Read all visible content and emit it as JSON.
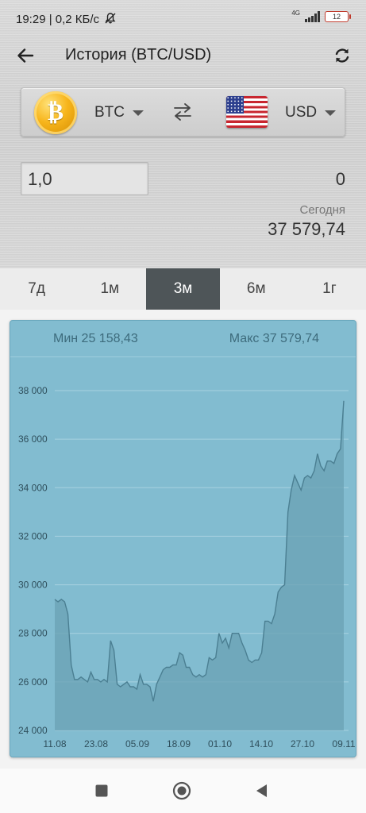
{
  "status": {
    "time_speed": "19:29 | 0,2 КБ/с",
    "network": "4G",
    "battery": "12"
  },
  "header": {
    "title": "История (BTC/USD)"
  },
  "converter": {
    "from_currency": "BTC",
    "to_currency": "USD",
    "amount": "1,0",
    "result": "0",
    "today_label": "Сегодня",
    "today_rate": "37 579,74"
  },
  "tabs": [
    {
      "label": "7д",
      "active": false
    },
    {
      "label": "1м",
      "active": false
    },
    {
      "label": "3м",
      "active": true
    },
    {
      "label": "6м",
      "active": false
    },
    {
      "label": "1г",
      "active": false
    }
  ],
  "chart_header": {
    "min": "Мин 25 158,43",
    "max": "Макс 37 579,74"
  },
  "chart_data": {
    "type": "area",
    "ylim": [
      24000,
      38500
    ],
    "yticks": [
      "24 000",
      "26 000",
      "28 000",
      "30 000",
      "32 000",
      "34 000",
      "36 000",
      "38 000"
    ],
    "ytick_values": [
      24000,
      26000,
      28000,
      30000,
      32000,
      34000,
      36000,
      38000
    ],
    "xticks": [
      "11.08",
      "23.08",
      "05.09",
      "18.09",
      "01.10",
      "14.10",
      "27.10",
      "09.11"
    ],
    "grid": true,
    "series": [
      {
        "values": [
          29400,
          29300,
          29400,
          29300,
          28800,
          26700,
          26100,
          26100,
          26200,
          26100,
          26000,
          26400,
          26100,
          26100,
          26000,
          26100,
          26000,
          27700,
          27300,
          25900,
          25800,
          25900,
          26000,
          25800,
          25800,
          25700,
          26300,
          25900,
          25900,
          25800,
          25200,
          25900,
          26200,
          26500,
          26600,
          26600,
          26700,
          26700,
          27200,
          27100,
          26600,
          26600,
          26300,
          26200,
          26300,
          26200,
          26300,
          27000,
          26900,
          27000,
          28000,
          27600,
          27800,
          27400,
          28000,
          28000,
          28000,
          27600,
          27300,
          26900,
          26800,
          26900,
          26900,
          27200,
          28500,
          28500,
          28400,
          28800,
          29700,
          29900,
          30000,
          33000,
          33900,
          34500,
          34200,
          33900,
          34400,
          34500,
          34400,
          34700,
          35400,
          34900,
          34700,
          35100,
          35100,
          35000,
          35400,
          35600,
          37580
        ]
      }
    ],
    "colors": {
      "fill": "#6aa1b4",
      "line": "#4b7f92",
      "grid": "#a8d2e0",
      "background": "#82bcd0"
    }
  }
}
